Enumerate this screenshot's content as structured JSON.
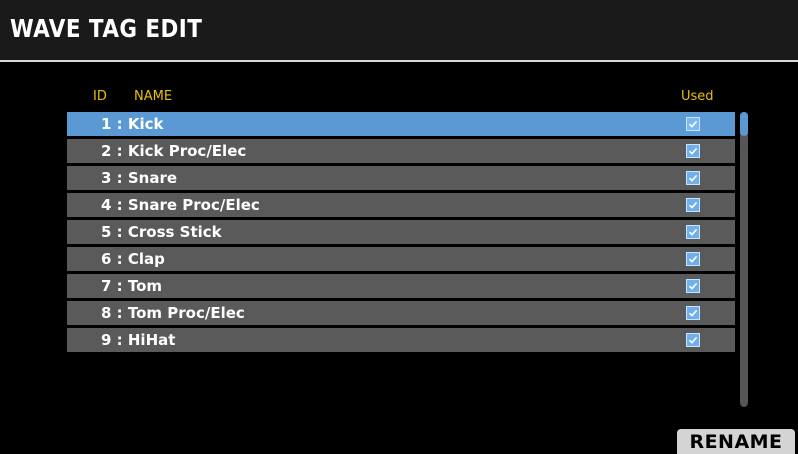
{
  "header": {
    "title": "WAVE TAG EDIT"
  },
  "columns": {
    "id_label": "ID",
    "name_label": "NAME",
    "used_label": "Used"
  },
  "list": {
    "selected_index": 0,
    "items": [
      {
        "label": "1 : Kick",
        "used": true
      },
      {
        "label": "2 : Kick Proc/Elec",
        "used": true
      },
      {
        "label": "3 : Snare",
        "used": true
      },
      {
        "label": "4 : Snare Proc/Elec",
        "used": true
      },
      {
        "label": "5 : Cross Stick",
        "used": true
      },
      {
        "label": "6 : Clap",
        "used": true
      },
      {
        "label": "7 : Tom",
        "used": true
      },
      {
        "label": "8 : Tom Proc/Elec",
        "used": true
      },
      {
        "label": "9 : HiHat",
        "used": true
      }
    ]
  },
  "footer": {
    "rename_label": "RENAME"
  },
  "colors": {
    "selected_row": "#5b99d4",
    "row": "#5a5a5a",
    "column_header": "#e8c200",
    "checkbox": "#6fb0ea"
  },
  "icons": {
    "checkbox": "checkbox-checked-icon"
  }
}
